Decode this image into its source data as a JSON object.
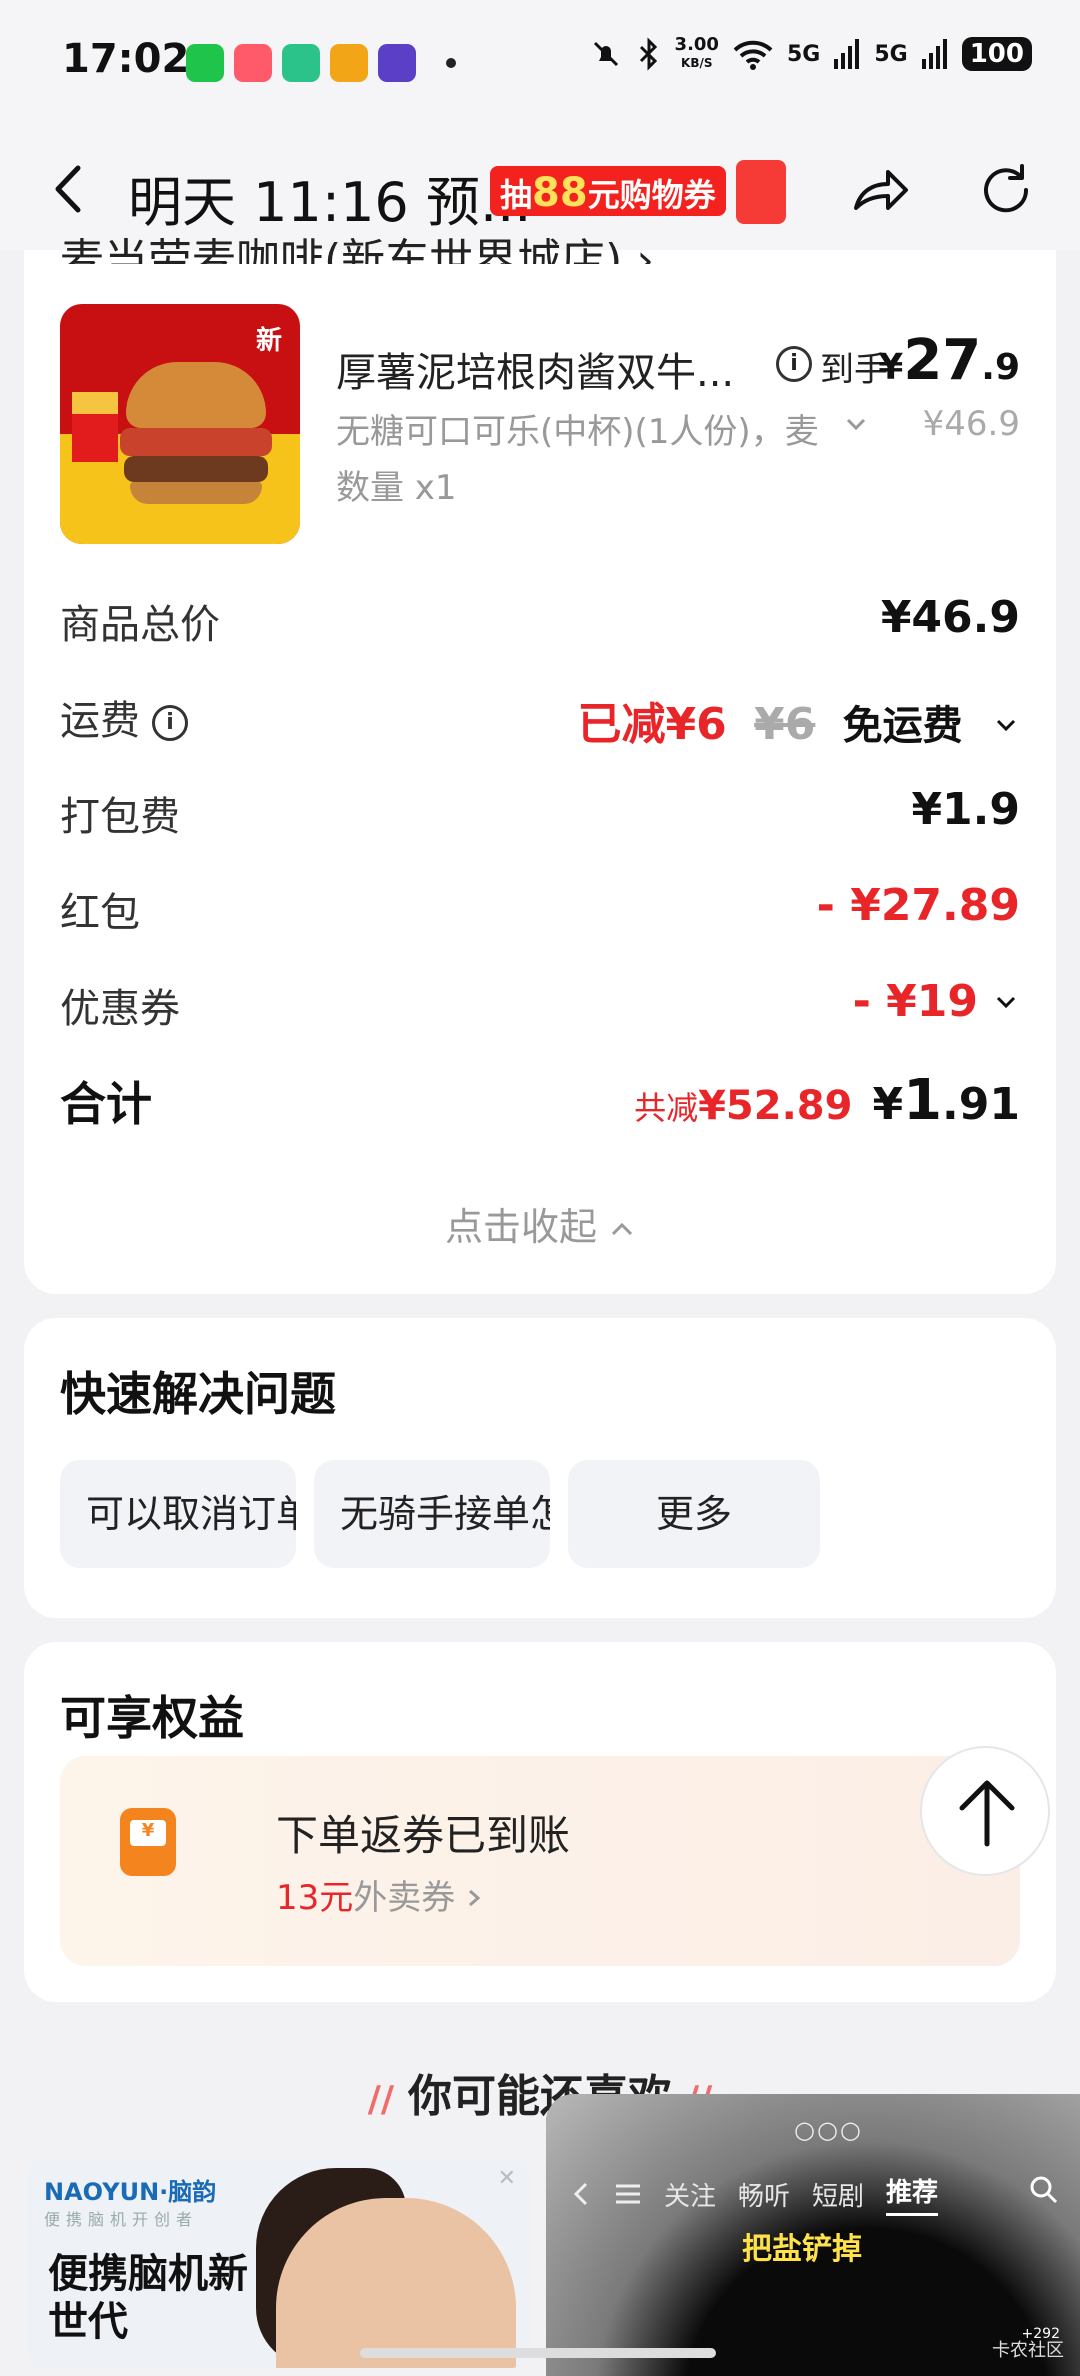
{
  "status_bar": {
    "time": "17:02",
    "speed_value": "3.00",
    "speed_unit": "KB/S",
    "signal1": "5G",
    "signal2": "5G",
    "battery": "100",
    "app_icons": [
      "wechat-icon",
      "app-icon",
      "app-icon",
      "weibo-icon",
      "app-icon"
    ]
  },
  "nav": {
    "title": "明天 11:16 预...",
    "promo_prefix": "抽",
    "promo_amount": "88",
    "promo_suffix": "元购物券"
  },
  "shop": {
    "name_partial": "麦当劳麦咖啡(新东世界城店) ›"
  },
  "item": {
    "name": "厚薯泥培根肉酱双牛...",
    "badge_new": "新",
    "daoshou_label": "到手",
    "price_currency": "¥",
    "price_int": "27",
    "price_dec": ".9",
    "spec": "无糖可口可乐(中杯)(1人份)，麦",
    "original_price": "¥46.9",
    "quantity": "数量 x1"
  },
  "summary": {
    "goods_total_label": "商品总价",
    "goods_total_value": "¥46.9",
    "shipping_label": "运费",
    "shipping_reduced": "已减¥6",
    "shipping_original": "¥6",
    "shipping_free": "免运费",
    "packing_label": "打包费",
    "packing_value": "¥1.9",
    "hongbao_label": "红包",
    "hongbao_value": "- ¥27.89",
    "coupon_label": "优惠券",
    "coupon_value": "- ¥19",
    "total_label": "合计",
    "total_saved_prefix": "共减",
    "total_saved_value": "¥52.89",
    "total_currency": "¥",
    "total_int": "1",
    "total_dec": ".91",
    "collapse_label": "点击收起"
  },
  "quick_help": {
    "title": "快速解决问题",
    "buttons": [
      "可以取消订单...",
      "无骑手接单怎...",
      "更多"
    ]
  },
  "benefits": {
    "title": "可享权益",
    "coupon_title": "下单返券已到账",
    "coupon_amount": "13元",
    "coupon_type": "外卖券"
  },
  "recommend": {
    "title": "你可能还喜欢"
  },
  "ad": {
    "brand": "NAOYUN·脑韵",
    "tagline": "便携脑机开创者",
    "headline": "便携脑机新世代"
  },
  "video": {
    "tabs": [
      "关注",
      "畅听",
      "短剧",
      "推荐"
    ],
    "subtitle": "把盐铲掉",
    "credit": "卡农社区",
    "count": "+292"
  }
}
